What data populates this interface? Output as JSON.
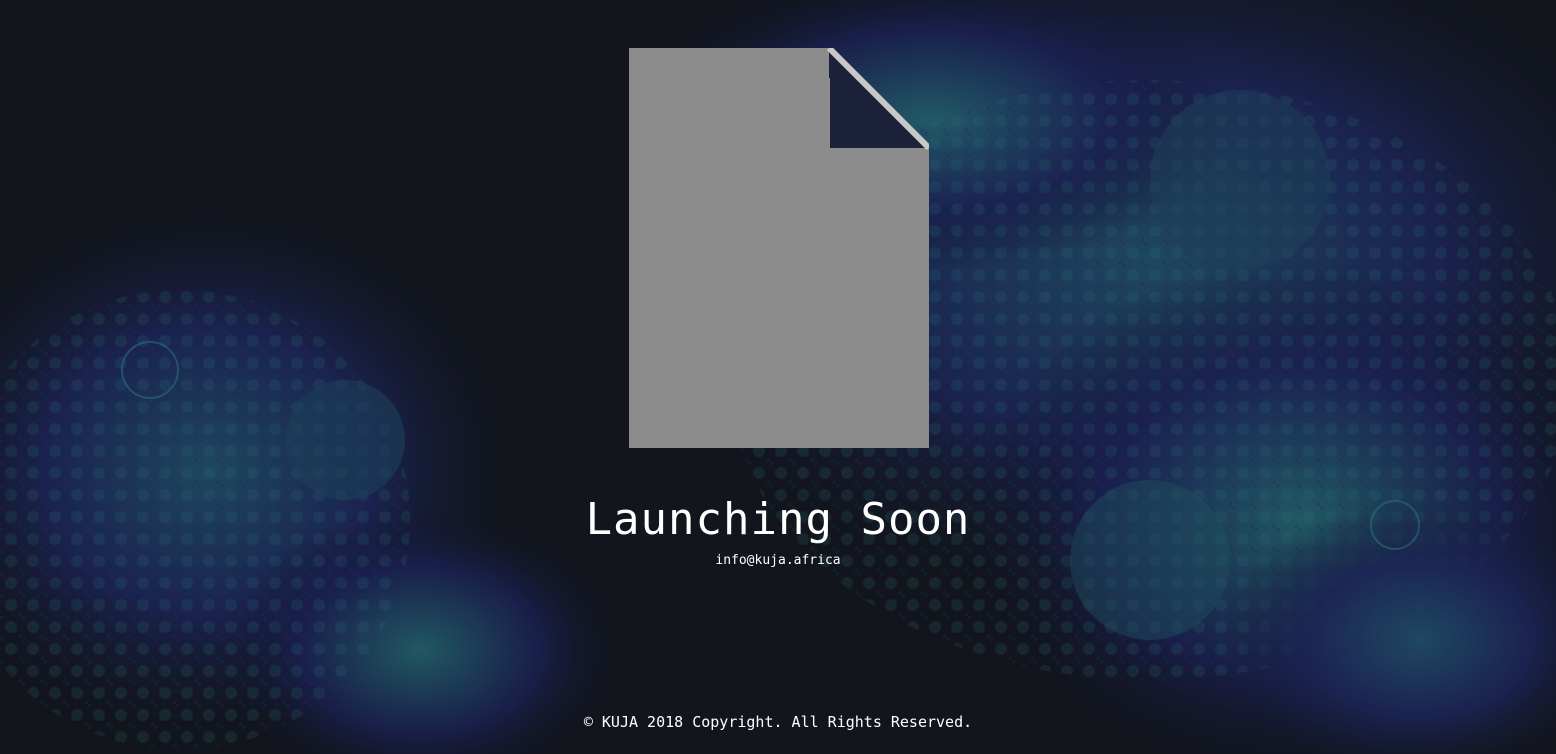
{
  "main": {
    "title": "Launching Soon",
    "email": "info@kuja.africa",
    "logo_image_icon": "broken-image-icon"
  },
  "footer": {
    "copyright": "© KUJA 2018 Copyright. All Rights Reserved."
  },
  "colors": {
    "background": "#12151c",
    "fractal_dark": "#1b1f45",
    "fractal_teal": "#1e5a5c",
    "text": "#ffffff",
    "placeholder_gray": "#8c8c8c"
  }
}
